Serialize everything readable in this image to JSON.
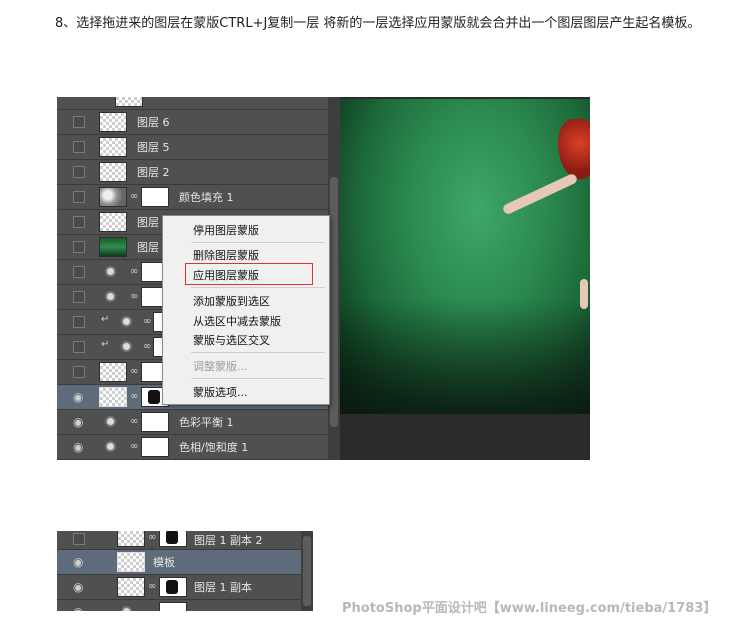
{
  "instruction": "8、选择拖进来的图层在蒙版CTRL+J复制一层 将新的一层选择应用蒙版就会合并出一个图层图层产生起名模板。",
  "panel1": {
    "layers": [
      {
        "name": "图层 6"
      },
      {
        "name": "图层 5"
      },
      {
        "name": "图层 2"
      },
      {
        "name": "颜色填充 1"
      },
      {
        "name": "图层"
      },
      {
        "name": "图层"
      },
      {
        "name": ""
      },
      {
        "name": ""
      },
      {
        "name": ""
      },
      {
        "name": ""
      },
      {
        "name": ""
      },
      {
        "name": ""
      },
      {
        "name": "色彩平衡 1"
      },
      {
        "name": "色相/饱和度 1"
      }
    ]
  },
  "context_menu": {
    "items": [
      "停用图层蒙版",
      "删除图层蒙版",
      "应用图层蒙版",
      "添加蒙版到选区",
      "从选区中减去蒙版",
      "蒙版与选区交叉",
      "调整蒙版...",
      "蒙版选项..."
    ],
    "highlighted": "应用图层蒙版",
    "highlight_color": "#e03030"
  },
  "panel2": {
    "layers": [
      {
        "name": "图层 1 副本 2"
      },
      {
        "name": "模板"
      },
      {
        "name": "图层 1 副本"
      }
    ]
  },
  "watermark": "PhotoShop平面设计吧【www.lineeg.com/tieba/1783】",
  "colors": {
    "panel_bg": "#4a4a4a",
    "canvas_green": "#2b8a4f",
    "menu_bg": "#f0f0f0"
  }
}
